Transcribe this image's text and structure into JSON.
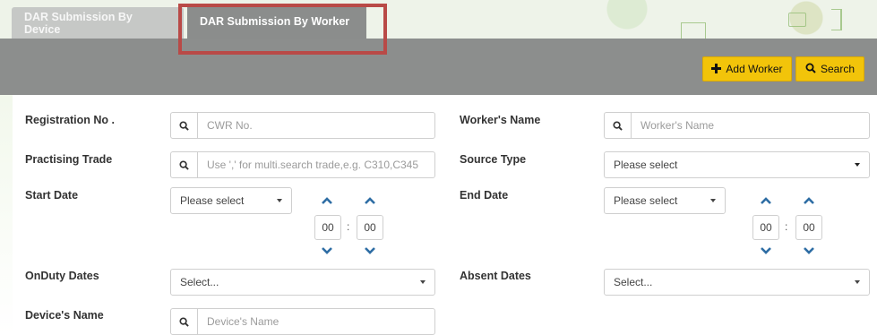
{
  "tabs": [
    {
      "label": "DAR Submission By Device",
      "active": false
    },
    {
      "label": "DAR Submission By Worker",
      "active": true
    }
  ],
  "toolbar": {
    "add_label": "Add Worker",
    "search_label": "Search"
  },
  "form": {
    "registration": {
      "label": "Registration No .",
      "placeholder": "CWR No."
    },
    "worker_name": {
      "label": "Worker's Name",
      "placeholder": "Worker's Name"
    },
    "trade": {
      "label": "Practising Trade",
      "placeholder": "Use ',' for multi.search trade,e.g. C310,C345"
    },
    "source_type": {
      "label": "Source Type",
      "value": "Please select"
    },
    "start_date": {
      "label": "Start Date",
      "value": "Please select",
      "hour": "00",
      "minute": "00"
    },
    "end_date": {
      "label": "End Date",
      "value": "Please select",
      "hour": "00",
      "minute": "00"
    },
    "onduty": {
      "label": "OnDuty Dates",
      "value": "Select..."
    },
    "absent": {
      "label": "Absent Dates",
      "value": "Select..."
    },
    "device_name": {
      "label": "Device's Name",
      "placeholder": "Device's Name"
    }
  },
  "colors": {
    "toolbar_bg": "#8c8e8d",
    "button_accent": "#f2c40a",
    "highlight_border": "#b94a47",
    "chevron": "#2e6da4"
  }
}
